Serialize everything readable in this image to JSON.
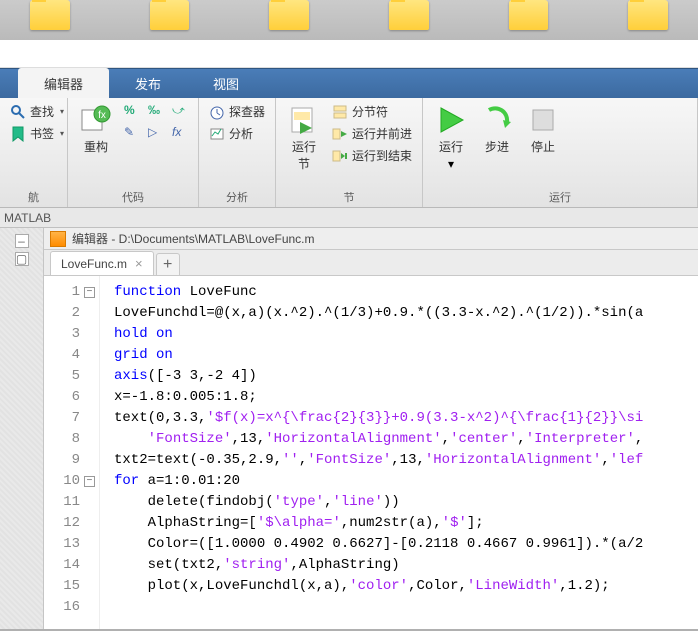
{
  "tabs": {
    "editor": "编辑器",
    "publish": "发布",
    "view": "视图"
  },
  "nav": {
    "find": "查找",
    "bookmark": "书签",
    "navGroup": "航"
  },
  "codeGroup": {
    "title": "代码",
    "refactor": "重构",
    "b1": "%",
    "b2": "‰",
    "b3": "⤻",
    "b4": "✎",
    "b5": "▷",
    "b6": "fx"
  },
  "analyzeGroup": {
    "title": "分析",
    "explorer": "探查器",
    "analyze": "分析"
  },
  "sectionGroup": {
    "title": "节",
    "runSection": "运行\n节",
    "split": "分节符",
    "runAdvance": "运行并前进",
    "runToEnd": "运行到结束"
  },
  "runGroup": {
    "title": "运行",
    "run": "运行",
    "step": "步进",
    "stop": "停止"
  },
  "pathbar": "MATLAB",
  "editorHeader": "编辑器 - D:\\Documents\\MATLAB\\LoveFunc.m",
  "fileTab": "LoveFunc.m",
  "lines": [
    "function LoveFunc",
    "LoveFunchdl=@(x,a)(x.^2).^(1/3)+0.9.*((3.3-x.^2).^(1/2)).*sin(a",
    "hold on",
    "grid on",
    "axis([-3 3,-2 4])",
    "x=-1.8:0.005:1.8;",
    "text(0,3.3,'$f(x)=x^{\\frac{2}{3}}+0.9(3.3-x^2)^{\\frac{1}{2}}\\si",
    "    'FontSize',13,'HorizontalAlignment','center','Interpreter',",
    "txt2=text(-0.35,2.9,'','FontSize',13,'HorizontalAlignment','lef",
    "for a=1:0.01:20",
    "    delete(findobj('type','line'))",
    "    AlphaString=['$\\alpha=',num2str(a),'$'];",
    "    Color=([1.0000 0.4902 0.6627]-[0.2118 0.4667 0.9961]).*(a/2",
    "    set(txt2,'string',AlphaString)",
    "    plot(x,LoveFunchdl(x,a),'color',Color,'LineWidth',1.2);",
    ""
  ]
}
